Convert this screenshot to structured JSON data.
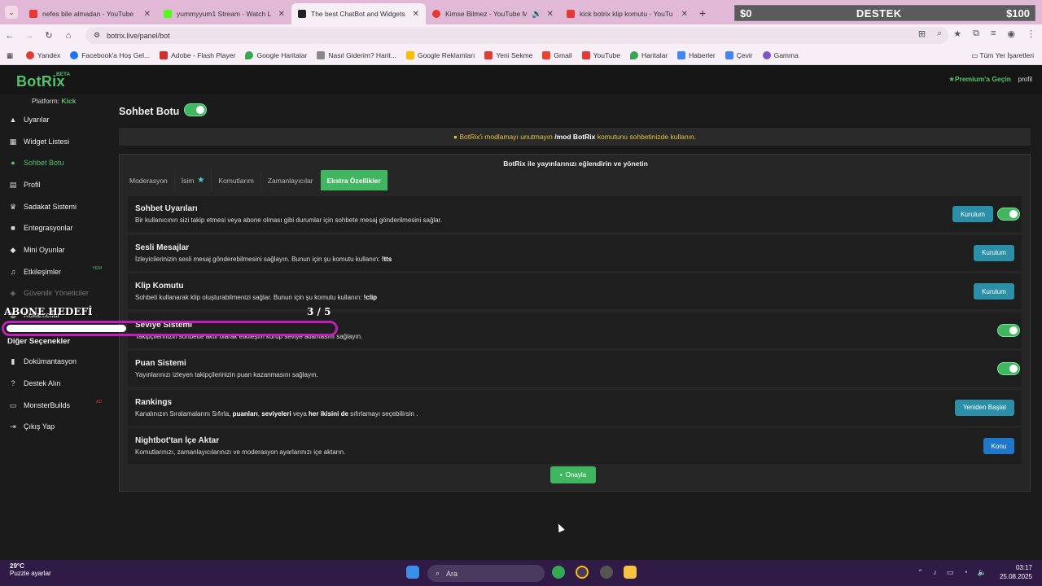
{
  "browser": {
    "tabs": [
      {
        "title": "nefes bile almadan - YouTube",
        "color": "#e53935"
      },
      {
        "title": "yummyyum1 Stream - Watch L",
        "color": "#53fc18"
      },
      {
        "title": "The best ChatBot and Widgets",
        "color": "#222222"
      },
      {
        "title": "Kimse Bilmez - YouTube Mu",
        "color": "#e53935"
      },
      {
        "title": "kick botrix klip komutu - YouTu",
        "color": "#e53935"
      }
    ],
    "url": "botrix.live/panel/bot",
    "bookmarks": [
      "Yandex",
      "Facebook'a Hoş Gel...",
      "Adobe - Flash Player",
      "Google Haritalar",
      "Nasıl Giderim? Harit...",
      "Google Reklamları",
      "Yeni Sekme",
      "Gmail",
      "YouTube",
      "Haritalar",
      "Haberler",
      "Çevir",
      "Gamma"
    ],
    "all_bookmarks": "Tüm Yer İşaretleri"
  },
  "stream_overlay": {
    "left": "$0",
    "center": "DESTEK",
    "right": "$100"
  },
  "app": {
    "logo": "BotRix",
    "beta": "BETA",
    "premium": "Premium'a Geçin",
    "profile": "profil",
    "platform_label": "Platform:",
    "platform_value": "Kick"
  },
  "sidebar": {
    "items": [
      {
        "label": "Uyarılar",
        "icon": "warning-icon"
      },
      {
        "label": "Widget Listesi",
        "icon": "grid-icon"
      },
      {
        "label": "Sohbet Botu",
        "icon": "robot-icon",
        "active": true
      },
      {
        "label": "Profil",
        "icon": "id-card-icon"
      },
      {
        "label": "Sadakat Sistemi",
        "icon": "trophy-icon"
      },
      {
        "label": "Entegrasyonlar",
        "icon": "plug-icon"
      },
      {
        "label": "Mini Oyunlar",
        "icon": "gamepad-icon"
      },
      {
        "label": "Etkileşimler",
        "icon": "music-icon",
        "badge": "YENI"
      },
      {
        "label": "Güvenilir Yöneticiler",
        "icon": "user-shield-icon"
      },
      {
        "label": "Kullanıcılar",
        "icon": "users-icon"
      }
    ],
    "other_heading": "Diğer Seçenekler",
    "other_items": [
      {
        "label": "Dokümantasyon",
        "icon": "book-icon"
      },
      {
        "label": "Destek Alın",
        "icon": "question-icon"
      },
      {
        "label": "MonsterBuilds",
        "icon": "monitor-icon",
        "badge": "AD"
      },
      {
        "label": "Çıkış Yap",
        "icon": "logout-icon"
      }
    ]
  },
  "main": {
    "title": "Sohbet Botu",
    "notice_pre": "BotRix'i modlamayı unutmayın",
    "notice_cmd": "/mod BotRix",
    "notice_post": "komutunu sohbetinizde kullanın.",
    "panel_title": "BotRix ile yayınlarınızı eğlendirin ve yönetin",
    "tabs": [
      "Moderasyon",
      "İsim",
      "Komutlarım",
      "Zamanlayıcılar",
      "Ekstra Özellikler"
    ],
    "rows": [
      {
        "title": "Sohbet Uyarıları",
        "desc": "Bir kullanıcının sizi takip etmesi veya abone olması gibi durumlar için sohbete mesaj gönderilmesini sağlar.",
        "button": "Kurulum",
        "toggle": true
      },
      {
        "title": "Sesli Mesajlar",
        "desc": "İzleyicilerinizin sesli mesaj gönderebilmesini sağlayın. Bunun için şu komutu kullanın:",
        "cmd": "!tts",
        "button": "Kurulum",
        "toggle": false
      },
      {
        "title": "Klip Komutu",
        "desc": "Sohbeti kullanarak klip oluşturabilmenizi sağlar. Bunun için şu komutu kullanın:",
        "cmd": "!clip",
        "button": "Kurulum",
        "toggle": false
      },
      {
        "title": "Seviye Sistemi",
        "desc": "Takipçilerinizin sohbette aktif olarak etkileşim kurup seviye atlamasını sağlayın.",
        "button": "",
        "toggle": true
      },
      {
        "title": "Puan Sistemi",
        "desc": "Yayınlarınızı izleyen takipçilerinizin puan kazanmasını sağlayın.",
        "button": "",
        "toggle": true
      },
      {
        "title": "Rankings",
        "desc": "Kanalınızın Sıralamalarını Sıfırla,",
        "button": "Yeniden Başlat",
        "toggle": false
      },
      {
        "title": "Nightbot'tan İçe Aktar",
        "desc": "Komutlarınızı, zamanlayıcılarınızı ve moderasyon ayarlarınızı içe aktarın.",
        "button": "Konu",
        "toggle": false
      }
    ],
    "rankings_parts": {
      "a": "puanları",
      "b": ", ",
      "c": "seviyeleri",
      "d": " veya ",
      "e": "her ikisini de",
      "f": " sıfırlamayı seçebilirsin ."
    },
    "save": "Onayla"
  },
  "overlay": {
    "title": "ABONE HEDEFİ",
    "count": "3   / 5",
    "progress": 0.6
  },
  "taskbar": {
    "temp": "29°C",
    "weather_text": "Puzzle ayarlar",
    "search": "Ara",
    "time": "03:17",
    "date": "25.08.2025"
  }
}
